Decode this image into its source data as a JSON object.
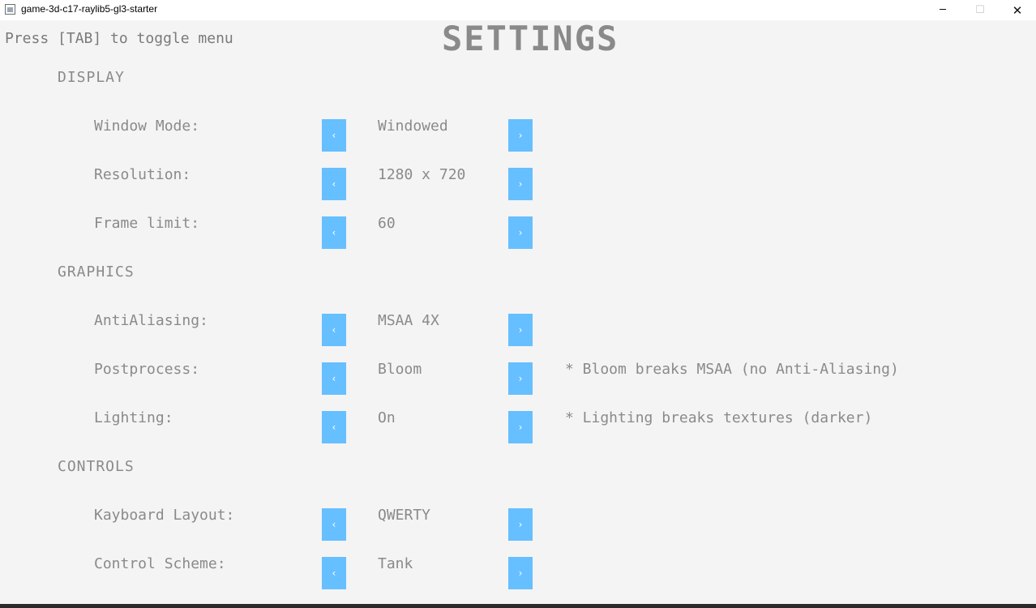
{
  "window": {
    "title": "game-3d-c17-raylib5-gl3-starter",
    "minimize_glyph": "─",
    "maximize_glyph": "☐",
    "close_glyph": "✕"
  },
  "hint": "Press [TAB] to toggle menu",
  "page_title": "SETTINGS",
  "arrows": {
    "prev": "‹",
    "next": "›"
  },
  "sections": {
    "display": "DISPLAY",
    "graphics": "GRAPHICS",
    "controls": "CONTROLS"
  },
  "settings": {
    "window_mode": {
      "label": "Window Mode:",
      "value": "Windowed"
    },
    "resolution": {
      "label": "Resolution:",
      "value": "1280 x 720"
    },
    "frame_limit": {
      "label": "Frame limit:",
      "value": "60"
    },
    "antialiasing": {
      "label": "AntiAliasing:",
      "value": "MSAA 4X"
    },
    "postprocess": {
      "label": "Postprocess:",
      "value": "Bloom",
      "note": "* Bloom breaks MSAA (no Anti-Aliasing)"
    },
    "lighting": {
      "label": "Lighting:",
      "value": "On",
      "note": "* Lighting breaks textures (darker)"
    },
    "keyboard_layout": {
      "label": "Kayboard Layout:",
      "value": "QWERTY"
    },
    "control_scheme": {
      "label": "Control Scheme:",
      "value": "Tank"
    }
  },
  "colors": {
    "background": "#f4f4f4",
    "button": "#66bfff",
    "text": "#8a8a8a"
  }
}
